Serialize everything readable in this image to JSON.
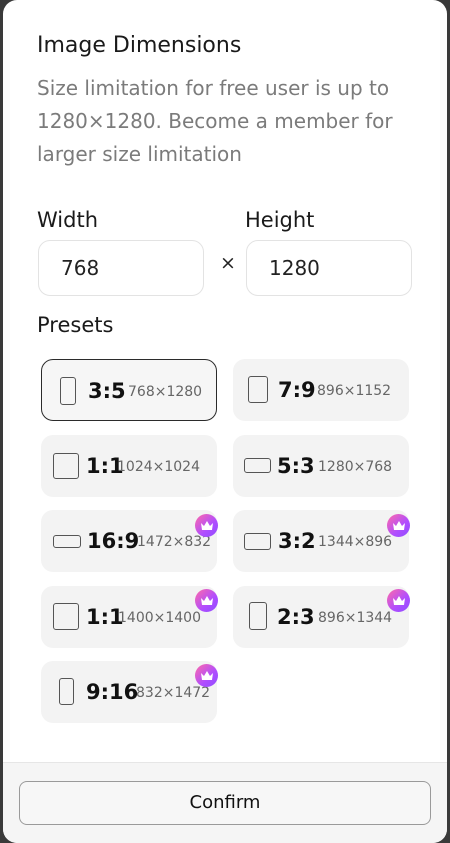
{
  "dialog": {
    "title": "Image Dimensions",
    "description": "Size limitation for free user is up to 1280×1280. Become a member for larger size limitation"
  },
  "width": {
    "label": "Width",
    "value": "768"
  },
  "height": {
    "label": "Height",
    "value": "1280"
  },
  "separator": "×",
  "presets": {
    "label": "Presets",
    "items": [
      {
        "ratio": "3:5",
        "dims": "768×1280",
        "selected": true,
        "premium": false,
        "shape": "portrait"
      },
      {
        "ratio": "7:9",
        "dims": "896×1152",
        "selected": false,
        "premium": false,
        "shape": "portrait"
      },
      {
        "ratio": "1:1",
        "dims": "1024×1024",
        "selected": false,
        "premium": false,
        "shape": "square"
      },
      {
        "ratio": "5:3",
        "dims": "1280×768",
        "selected": false,
        "premium": false,
        "shape": "landscape"
      },
      {
        "ratio": "16:9",
        "dims": "1472×832",
        "selected": false,
        "premium": true,
        "shape": "wide"
      },
      {
        "ratio": "3:2",
        "dims": "1344×896",
        "selected": false,
        "premium": true,
        "shape": "landscape"
      },
      {
        "ratio": "1:1",
        "dims": "1400×1400",
        "selected": false,
        "premium": true,
        "shape": "square"
      },
      {
        "ratio": "2:3",
        "dims": "896×1344",
        "selected": false,
        "premium": true,
        "shape": "portrait"
      },
      {
        "ratio": "9:16",
        "dims": "832×1472",
        "selected": false,
        "premium": true,
        "shape": "tall"
      }
    ]
  },
  "footer": {
    "confirm_label": "Confirm"
  },
  "icons": {
    "premium": "crown-icon"
  },
  "colors": {
    "premium_gradient_start": "#ff6aa8",
    "premium_gradient_end": "#8f4dff",
    "selected_border": "#2b2b2b"
  }
}
